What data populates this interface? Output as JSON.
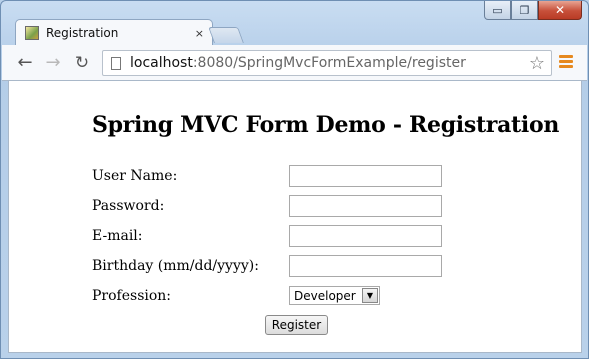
{
  "window": {
    "controls": {
      "minimize": "▭",
      "maximize": "❐",
      "close": "✕"
    }
  },
  "tabs": [
    {
      "title": "Registration",
      "close": "×",
      "favicon": "page-favicon"
    }
  ],
  "toolbar": {
    "back": "←",
    "forward": "→",
    "reload": "↻",
    "url_host": "localhost",
    "url_path": ":8080/SpringMvcFormExample/register",
    "bookmark": "☆",
    "menu_icon": "hamburger-menu-icon",
    "menu_color": "#e6891f"
  },
  "page": {
    "title": "Spring MVC Form Demo - Registration",
    "fields": {
      "username": {
        "label": "User Name:",
        "value": ""
      },
      "password": {
        "label": "Password:",
        "value": ""
      },
      "email": {
        "label": "E-mail:",
        "value": ""
      },
      "birthday": {
        "label": "Birthday (mm/dd/yyyy):",
        "value": ""
      },
      "profession": {
        "label": "Profession:",
        "selected": "Developer",
        "arrow": "▼"
      }
    },
    "submit_label": "Register"
  }
}
